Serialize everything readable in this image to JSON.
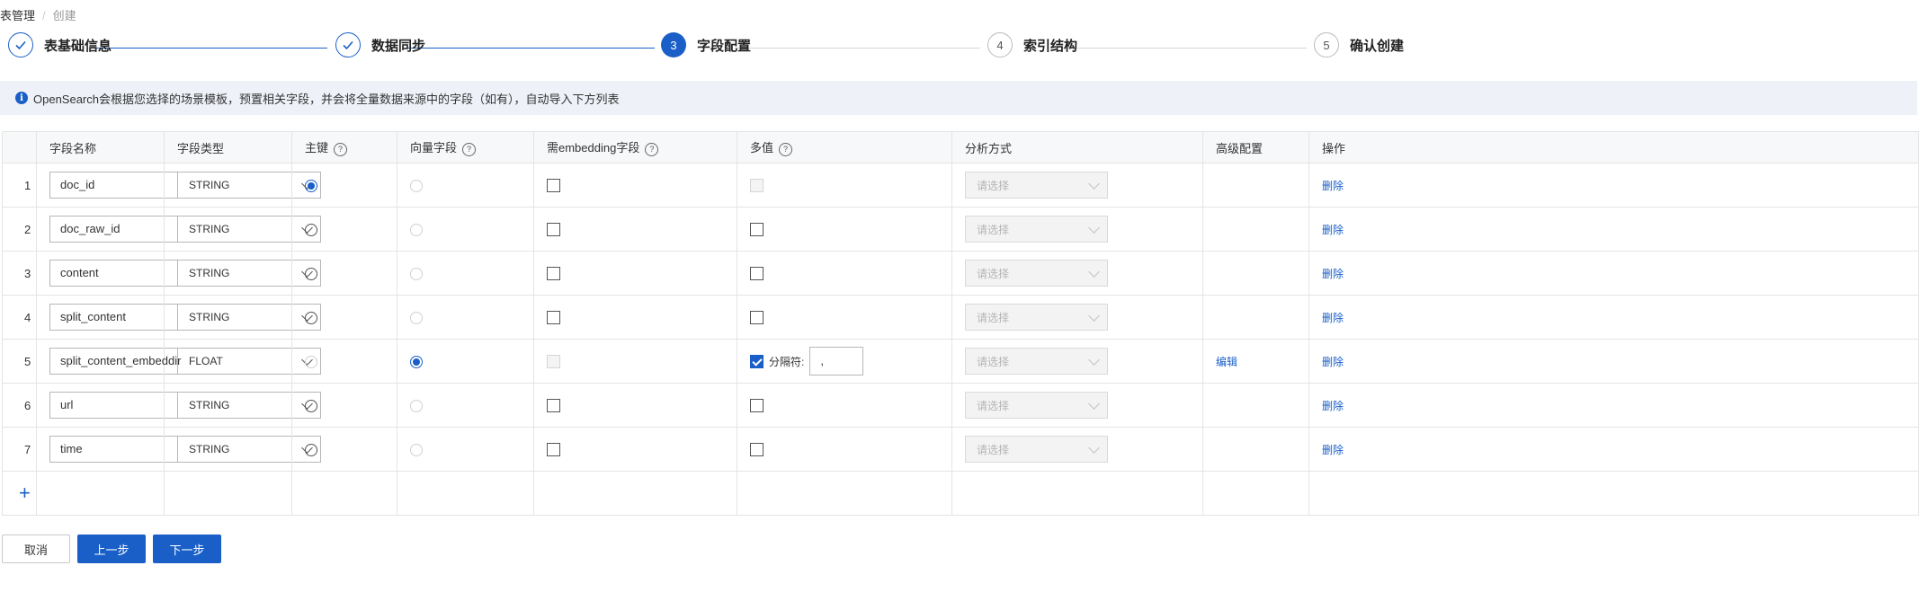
{
  "breadcrumb": {
    "parent": "表管理",
    "separator": "/",
    "current": "创建"
  },
  "steps": [
    {
      "number": "",
      "label": "表基础信息",
      "state": "done"
    },
    {
      "number": "",
      "label": "数据同步",
      "state": "done"
    },
    {
      "number": "3",
      "label": "字段配置",
      "state": "active"
    },
    {
      "number": "4",
      "label": "索引结构",
      "state": "todo"
    },
    {
      "number": "5",
      "label": "确认创建",
      "state": "todo"
    }
  ],
  "info": {
    "icon": "info-icon",
    "text": "OpenSearch会根据您选择的场景模板，预置相关字段，并会将全量数据来源中的字段（如有），自动导入下方列表"
  },
  "table": {
    "headers": {
      "index": "",
      "name": "字段名称",
      "type": "字段类型",
      "primary": "主键",
      "vector": "向量字段",
      "embedding": "需embedding字段",
      "multi": "多值",
      "analyzer": "分析方式",
      "advanced": "高级配置",
      "action": "操作"
    },
    "help_icon": "question-circle-icon",
    "rows": [
      {
        "index": "1",
        "name": "doc_id",
        "type": "STRING",
        "primary": true,
        "vector": false,
        "embedding": false,
        "multi": false,
        "analyzer": "请选择",
        "advanced": "",
        "action": "删除"
      },
      {
        "index": "2",
        "name": "doc_raw_id",
        "type": "STRING",
        "primary": false,
        "vector": false,
        "embedding": false,
        "multi": false,
        "analyzer": "请选择",
        "advanced": "",
        "action": "删除"
      },
      {
        "index": "3",
        "name": "content",
        "type": "STRING",
        "primary": false,
        "vector": false,
        "embedding": false,
        "multi": false,
        "analyzer": "请选择",
        "advanced": "",
        "action": "删除"
      },
      {
        "index": "4",
        "name": "split_content",
        "type": "STRING",
        "primary": false,
        "vector": false,
        "embedding": false,
        "multi": false,
        "analyzer": "请选择",
        "advanced": "",
        "action": "删除"
      },
      {
        "index": "5",
        "name": "split_content_embeddir",
        "type": "FLOAT",
        "primary": false,
        "vector": true,
        "embedding": false,
        "multi": true,
        "separator_label": "分隔符:",
        "separator_value": ",",
        "analyzer": "请选择",
        "advanced": "编辑",
        "action": "删除"
      },
      {
        "index": "6",
        "name": "url",
        "type": "STRING",
        "primary": false,
        "vector": false,
        "embedding": false,
        "multi": false,
        "analyzer": "请选择",
        "advanced": "",
        "action": "删除"
      },
      {
        "index": "7",
        "name": "time",
        "type": "STRING",
        "primary": false,
        "vector": false,
        "embedding": false,
        "multi": false,
        "analyzer": "请选择",
        "advanced": "",
        "action": "删除"
      }
    ],
    "add_icon": "plus-icon"
  },
  "buttons": {
    "cancel": "取消",
    "prev": "上一步",
    "next": "下一步"
  },
  "colors": {
    "primary": "#1a5fc7",
    "info_bg": "#eef2f8",
    "header_bg": "#f7f8fa"
  }
}
